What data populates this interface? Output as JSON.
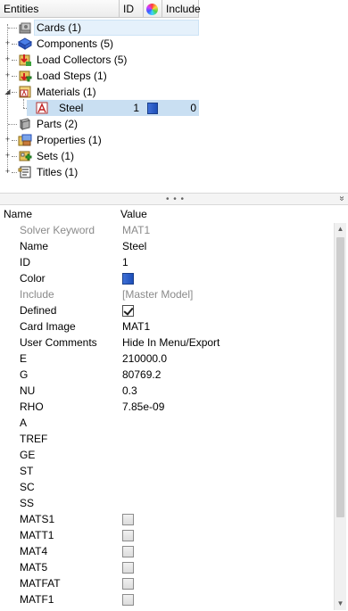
{
  "tree": {
    "columns": {
      "entities": "Entities",
      "id": "ID",
      "include": "Include"
    },
    "items": [
      {
        "label": "Cards (1)",
        "icon": "cards-icon"
      },
      {
        "label": "Components (5)",
        "icon": "components-icon"
      },
      {
        "label": "Load Collectors (5)",
        "icon": "load-collectors-icon"
      },
      {
        "label": "Load Steps (1)",
        "icon": "load-steps-icon"
      },
      {
        "label": "Materials (1)",
        "icon": "materials-icon",
        "expanded": true
      },
      {
        "label": "Steel",
        "icon": "material-icon",
        "id": "1",
        "include": "0",
        "color": "#2a5cc8"
      },
      {
        "label": "Parts (2)",
        "icon": "parts-icon"
      },
      {
        "label": "Properties (1)",
        "icon": "properties-icon"
      },
      {
        "label": "Sets (1)",
        "icon": "sets-icon"
      },
      {
        "label": "Titles (1)",
        "icon": "titles-icon"
      }
    ]
  },
  "splitter": {
    "dots": "• • •",
    "collapse_glyph": "»"
  },
  "properties": {
    "header": {
      "name": "Name",
      "value": "Value"
    },
    "rows": [
      {
        "name": "Solver Keyword",
        "value": "MAT1",
        "dim": true
      },
      {
        "name": "Name",
        "value": "Steel"
      },
      {
        "name": "ID",
        "value": "1"
      },
      {
        "name": "Color",
        "value": ""
      },
      {
        "name": "Include",
        "value": "[Master Model]",
        "dim": true
      },
      {
        "name": "Defined",
        "value": ""
      },
      {
        "name": "Card Image",
        "value": "MAT1"
      },
      {
        "name": "User Comments",
        "value": "Hide In Menu/Export"
      },
      {
        "name": "E",
        "value": "210000.0"
      },
      {
        "name": "G",
        "value": "80769.2"
      },
      {
        "name": "NU",
        "value": "0.3"
      },
      {
        "name": "RHO",
        "value": "7.85e-09"
      },
      {
        "name": "A",
        "value": ""
      },
      {
        "name": "TREF",
        "value": ""
      },
      {
        "name": "GE",
        "value": ""
      },
      {
        "name": "ST",
        "value": ""
      },
      {
        "name": "SC",
        "value": ""
      },
      {
        "name": "SS",
        "value": ""
      },
      {
        "name": "MATS1",
        "value": ""
      },
      {
        "name": "MATT1",
        "value": ""
      },
      {
        "name": "MAT4",
        "value": ""
      },
      {
        "name": "MAT5",
        "value": ""
      },
      {
        "name": "MATFAT",
        "value": ""
      },
      {
        "name": "MATF1",
        "value": ""
      }
    ],
    "defined_checked": true,
    "unchecked_flags": [
      "MATS1",
      "MATT1",
      "MAT4",
      "MAT5",
      "MATFAT",
      "MATF1"
    ],
    "material_color": "#2a5cc8"
  },
  "scrollbar": {
    "up": "▲",
    "down": "▼"
  }
}
